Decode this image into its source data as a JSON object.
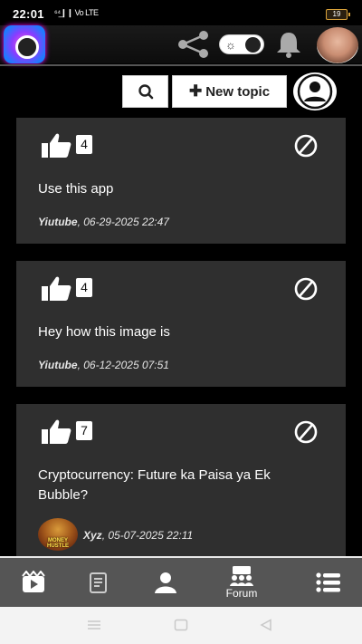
{
  "status_bar": {
    "time": "22:01",
    "signal": "⁶⁴̲❙❙ Vo LTE",
    "battery": "19"
  },
  "app": {
    "toggle_icon": "☼"
  },
  "actions": {
    "new_topic_label": "New topic",
    "new_topic_plus": "✚"
  },
  "posts": [
    {
      "likes": "4",
      "title": "Use this app",
      "author": "Yiutube",
      "date": ", 06-29-2025 22:47"
    },
    {
      "likes": "4",
      "title": "Hey how this image is",
      "author": "Yiutube",
      "date": ", 06-12-2025 07:51"
    },
    {
      "likes": "7",
      "title": "Cryptocurrency: Future ka Paisa ya Ek Bubble?",
      "author": "Xyz",
      "date": ", 05-07-2025 22:11",
      "thumb_text": "MONEY HUSTLE"
    }
  ],
  "bottom_nav": {
    "forum_label": "Forum"
  },
  "colors": {
    "card_bg": "#2f2f2f",
    "nav_bg": "#555555",
    "accent": "#ffffff"
  }
}
